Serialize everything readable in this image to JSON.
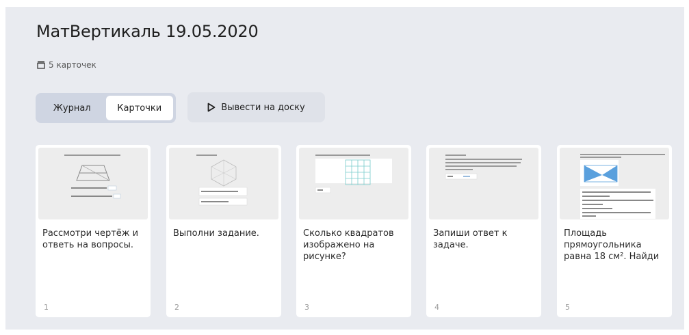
{
  "header": {
    "title": "МатВертикаль 19.05.2020",
    "card_count_label": "5 карточек",
    "card_count_icon": "cards-stack-icon"
  },
  "tabs": [
    {
      "label": "Журнал",
      "active": false
    },
    {
      "label": "Карточки",
      "active": true
    }
  ],
  "board_button": {
    "label": "Вывести на доску",
    "icon": "play-icon"
  },
  "cards": [
    {
      "text": "Рассмотри чертёж и ответь на вопросы.",
      "number": "1"
    },
    {
      "text": "Выполни задание.",
      "number": "2"
    },
    {
      "text": "Сколько квадратов изображено на рисунке?",
      "number": "3"
    },
    {
      "text": "Запиши ответ к задаче.",
      "number": "4"
    },
    {
      "text": "Площадь прямоугольника равна 18 см². Найди",
      "number": "5"
    }
  ],
  "colors": {
    "panel_bg": "#e9ebf0",
    "segment_bg": "#cfd5e2",
    "accent_blue": "#4a90d9"
  }
}
